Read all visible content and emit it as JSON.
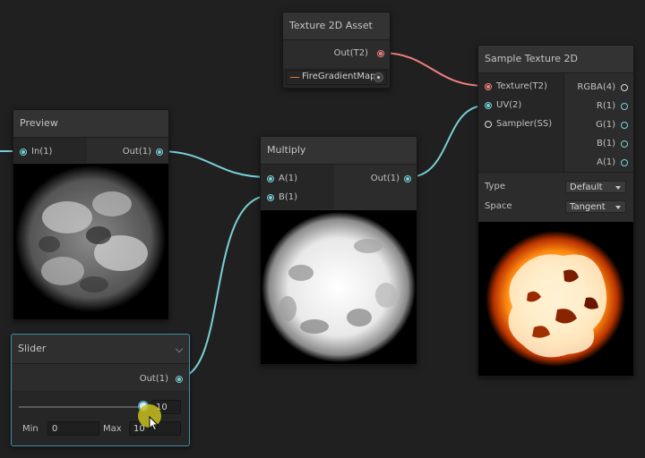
{
  "colors": {
    "canvas": "#202020",
    "wire_float": "#78d0d6",
    "wire_texture": "#f07f80",
    "slider_selection": "#4aa5b8",
    "cursor_highlight": "#c8c01e"
  },
  "texture_asset": {
    "title": "Texture 2D Asset",
    "output": "Out(T2)",
    "asset_name": "FireGradientMap",
    "picker_icon": "object-picker-icon"
  },
  "sample_texture": {
    "title": "Sample Texture 2D",
    "inputs": [
      "Texture(T2)",
      "UV(2)",
      "Sampler(SS)"
    ],
    "outputs": [
      "RGBA(4)",
      "R(1)",
      "G(1)",
      "B(1)",
      "A(1)"
    ],
    "type_label": "Type",
    "type_value": "Default",
    "space_label": "Space",
    "space_value": "Tangent"
  },
  "preview_node": {
    "title": "Preview",
    "input": "In(1)",
    "output": "Out(1)"
  },
  "multiply_node": {
    "title": "Multiply",
    "inputs": [
      "A(1)",
      "B(1)"
    ],
    "output": "Out(1)"
  },
  "slider_node": {
    "title": "Slider",
    "output": "Out(1)",
    "value": "10",
    "min_label": "Min",
    "min_value": "0",
    "max_label": "Max",
    "max_value": "10",
    "slider_level": 1.0
  }
}
